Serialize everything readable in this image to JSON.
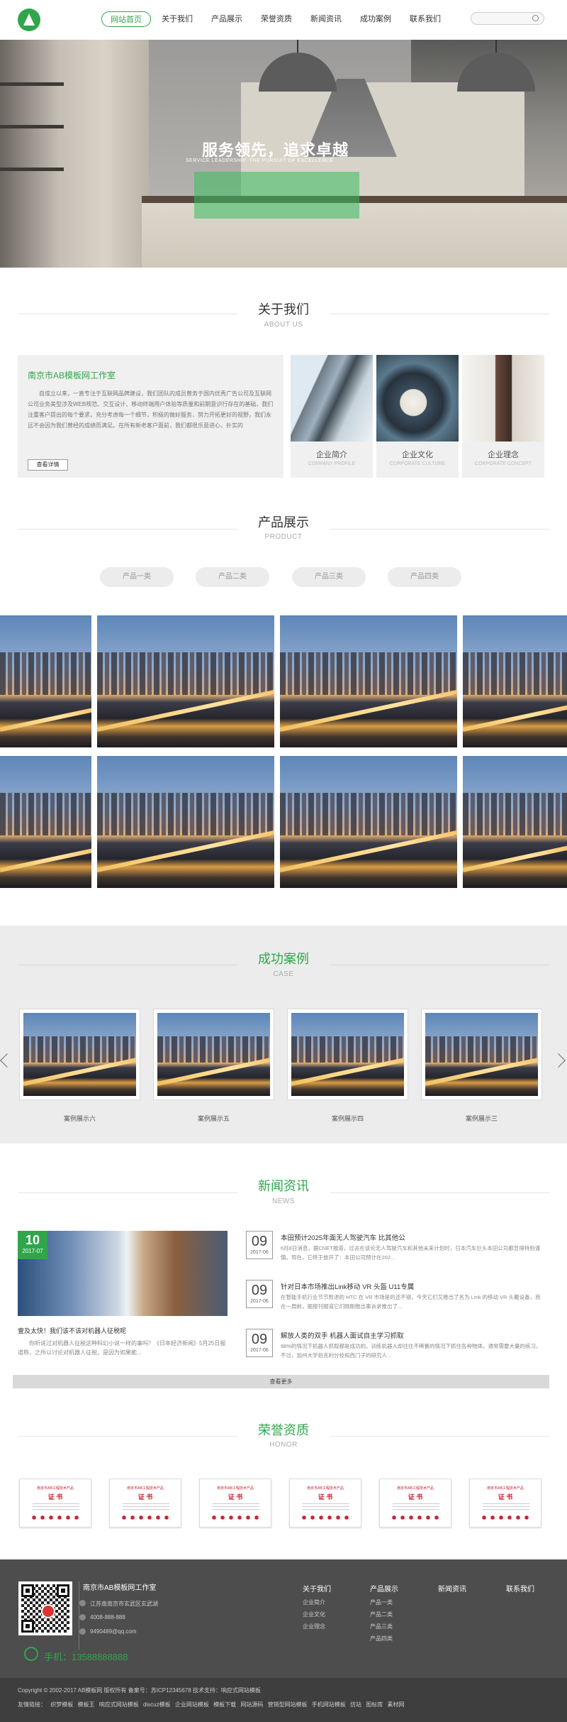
{
  "header": {
    "nav": [
      "网站首页",
      "关于我们",
      "产品展示",
      "荣誉资质",
      "新闻资讯",
      "成功案例",
      "联系我们"
    ]
  },
  "banner": {
    "title": "服务领先，追求卓越",
    "subtitle": "SERVICE LEADERSHIP, THE PURSUIT OF EXCELLENCE"
  },
  "about": {
    "title": "关于我们",
    "title_en": "ABOUT US",
    "company": "南京市AB模板网工作室",
    "text": "自成立以来，一直专注于互联网品牌建设，我们团队的成员曾务于国内优秀广告公司及互联网公司业务美型涉及WEB规范、交互设计、移动终端用户体验等质量和前期意识行存在的基础，我们注重客户提出的每个要求，充分考虑每一个细节，积极的做好服务，努力开拓更好的视野，我们永远不会因为我们曾经的成绩而满足。在所有新老客户面前，我们都很乐意进心，扑实的",
    "button": "查看详情",
    "cards": [
      {
        "title": "企业简介",
        "title_en": "COMPANY PROFILE"
      },
      {
        "title": "企业文化",
        "title_en": "CORPORATE CULTURE"
      },
      {
        "title": "企业理念",
        "title_en": "CORPORATE CONCEPT"
      }
    ]
  },
  "product": {
    "title": "产品展示",
    "title_en": "PRODUCT",
    "tabs": [
      "产品一类",
      "产品二类",
      "产品三类",
      "产品四类"
    ]
  },
  "case": {
    "title": "成功案例",
    "title_en": "CASE",
    "items": [
      "案例展示六",
      "案例展示五",
      "案例展示四",
      "案例展示三"
    ]
  },
  "news": {
    "title": "新闻资讯",
    "title_en": "NEWS",
    "featured": {
      "day": "10",
      "month": "2017-07",
      "title": "壹及太快！我们该不该对机器人征税呢",
      "desc": "你听说过对机器人征税这种科幻小说一样的事吗？《日本经济新闻》5月25日报道称，之所以讨论对机器人征税，是因为如果能..."
    },
    "items": [
      {
        "day": "09",
        "month": "2017-06",
        "title": "本田预计2025年面无人驾驶汽车 比其他公",
        "desc": "6月8日消息，据CNET报道，过去在谈论无人驾驶汽车和其他未来计划时，日本汽车巨头本田公司都显得特别谨慎。现在，它终于放开了：本田公司预计在202..."
      },
      {
        "day": "09",
        "month": "2017-06",
        "title": "针对日本市场推出Link移动 VR 头盔 U11专属",
        "desc": "在智能手机行业节节败退的 HTC 在 VR 市场是的还不错，今天它们又推出了名为 Link 的移动 VR 头戴设备，而在一周前，据报刊报道它们刚刚推出事诉求推出了..."
      },
      {
        "day": "09",
        "month": "2017-06",
        "title": "解放人类的双手 机器人面试自主学习抓取",
        "desc": "98%的情况下机器人抓取都是成功的。训练机器人却往往不稀置的情况下抓住各种物体，通常需要大量的练习。不过，加州大学伯克利分校和西门子的研究人..."
      }
    ],
    "more": "查看更多"
  },
  "honor": {
    "title": "荣誉资质",
    "title_en": "HONOR",
    "cert_heading": "南京市AB工程技术产品",
    "cert_word": "证 书",
    "count": 6
  },
  "footer": {
    "company": "南京市AB模板网工作室",
    "address": "江苏南南京市玄武区玄武湖",
    "tel": "4008-888-888",
    "email": "9490489@qq.com",
    "mobile": "手机：13588888888",
    "cols": [
      {
        "title": "关于我们",
        "items": [
          "企业简介",
          "企业文化",
          "企业理念"
        ]
      },
      {
        "title": "产品展示",
        "items": [
          "产品一类",
          "产品二类",
          "产品三类",
          "产品四类"
        ]
      },
      {
        "title": "新闻资讯",
        "items": []
      },
      {
        "title": "联系我们",
        "items": []
      }
    ],
    "copyright": "Copyright © 2002-2017 AB模板网 版权所有 备案号：苏ICP12345678 技术支持：响应式网站模板",
    "links_label": "友情链接：",
    "links": [
      "织梦模板",
      "模板王",
      "响应式网站模板",
      "discuz模板",
      "企业网站模板",
      "模板下载",
      "网站源码",
      "营销型网站模板",
      "手机网站模板",
      "仿站",
      "图标库",
      "素材网"
    ]
  },
  "colors": {
    "accent": "#2fa64c",
    "footer": "#4d4d4d"
  }
}
